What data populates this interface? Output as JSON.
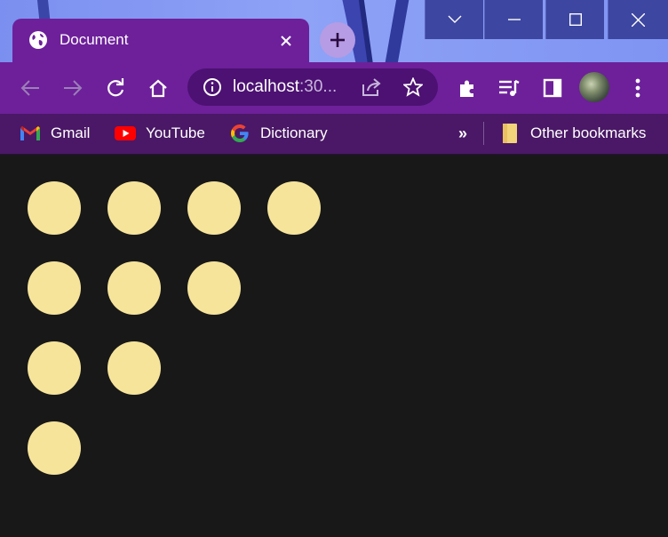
{
  "window": {
    "tab_title": "Document",
    "controls": [
      "tab-search",
      "minimize",
      "maximize",
      "close"
    ]
  },
  "toolbar": {
    "url_host": "localhost",
    "url_rest": ":30..."
  },
  "bookmarks": {
    "items": [
      {
        "label": "Gmail",
        "icon": "gmail-icon"
      },
      {
        "label": "YouTube",
        "icon": "youtube-icon"
      },
      {
        "label": "Dictionary",
        "icon": "google-icon"
      }
    ],
    "overflow": "»",
    "other": "Other bookmarks"
  },
  "page": {
    "background": "#181818",
    "circle_color": "#f6e49a",
    "rows": [
      4,
      3,
      2,
      1
    ]
  },
  "colors": {
    "tab": "#6d209a",
    "omnibox": "#4c1172",
    "bookmarks_bar": "#4a1866"
  }
}
